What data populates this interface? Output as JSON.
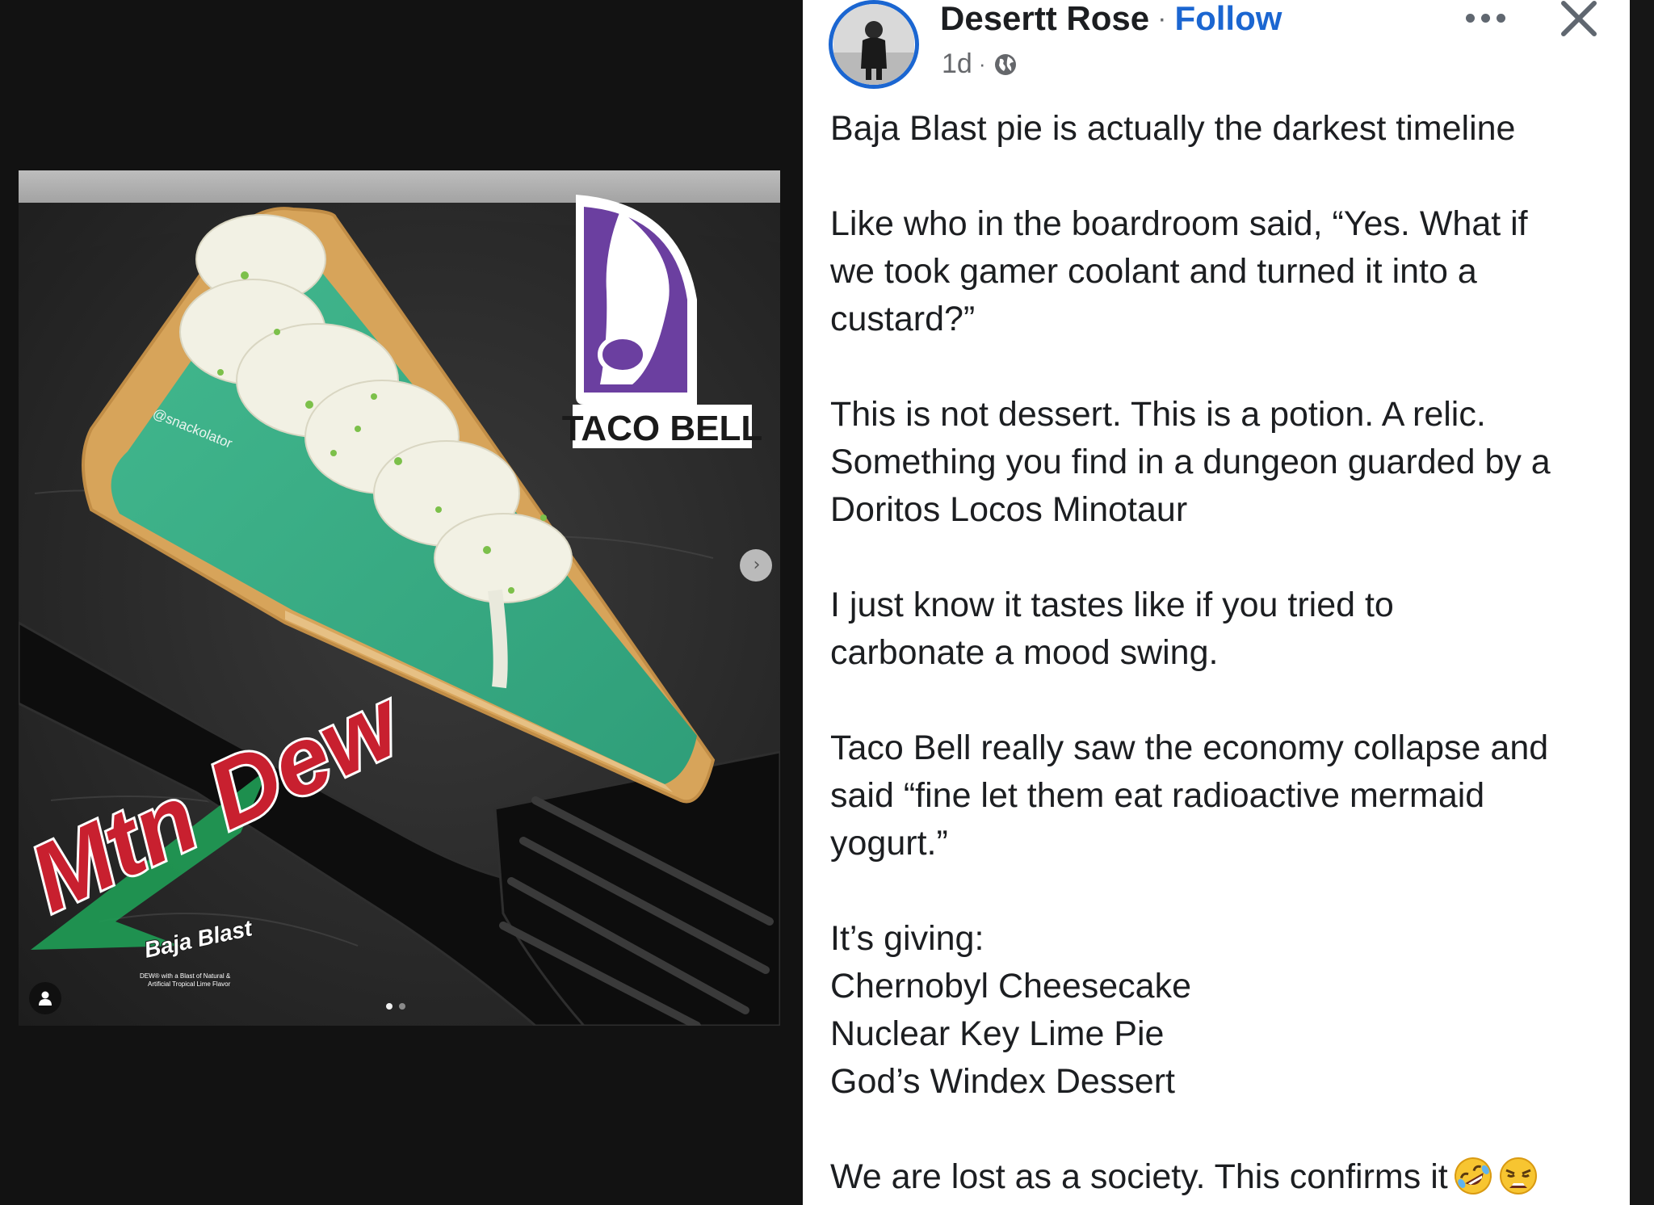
{
  "media": {
    "watermark": "@snackolator",
    "brand_logo_text": "TACO BELL",
    "drink_logo": {
      "brand": "Mtn Dew",
      "flavor": "Baja Blast",
      "fine_print": [
        "DEW® with a Blast of Natural &",
        "Artificial Tropical Lime Flavor"
      ]
    },
    "next_icon": "chevron-right-icon",
    "carousel": {
      "total": 2,
      "active_index": 0
    }
  },
  "post": {
    "author": "Desertt Rose",
    "separator": "·",
    "follow_label": "Follow",
    "timestamp": "1d",
    "meta_separator": "·",
    "privacy_icon": "globe-icon",
    "body": [
      [
        "Baja Blast pie is actually the darkest timeline"
      ],
      [
        "Like who in the boardroom said, “Yes. What if",
        "we took gamer coolant and turned it into a",
        "custard?”"
      ],
      [
        "This is not dessert. This is a potion. A relic.",
        "Something you find in a dungeon guarded by a",
        "Doritos Locos Minotaur"
      ],
      [
        "I just know it tastes like if you tried to",
        "carbonate a mood swing."
      ],
      [
        "Taco Bell really saw the economy collapse and",
        "said “fine let them eat radioactive mermaid",
        "yogurt.”"
      ],
      [
        "It’s giving:",
        "Chernobyl Cheesecake",
        "Nuclear Key Lime Pie",
        "God’s Windex Dessert"
      ],
      [
        "We are lost as a society. This confirms it"
      ]
    ],
    "end_emojis": [
      "rolling-on-floor-laughing-emoji",
      "weary-face-emoji"
    ]
  },
  "colors": {
    "follow_blue": "#1b66d1",
    "pie_filling": "#3fb28a",
    "taco_bell_purple": "#6b3fa0",
    "dew_red": "#c8202f",
    "dew_green": "#1f9d55"
  }
}
